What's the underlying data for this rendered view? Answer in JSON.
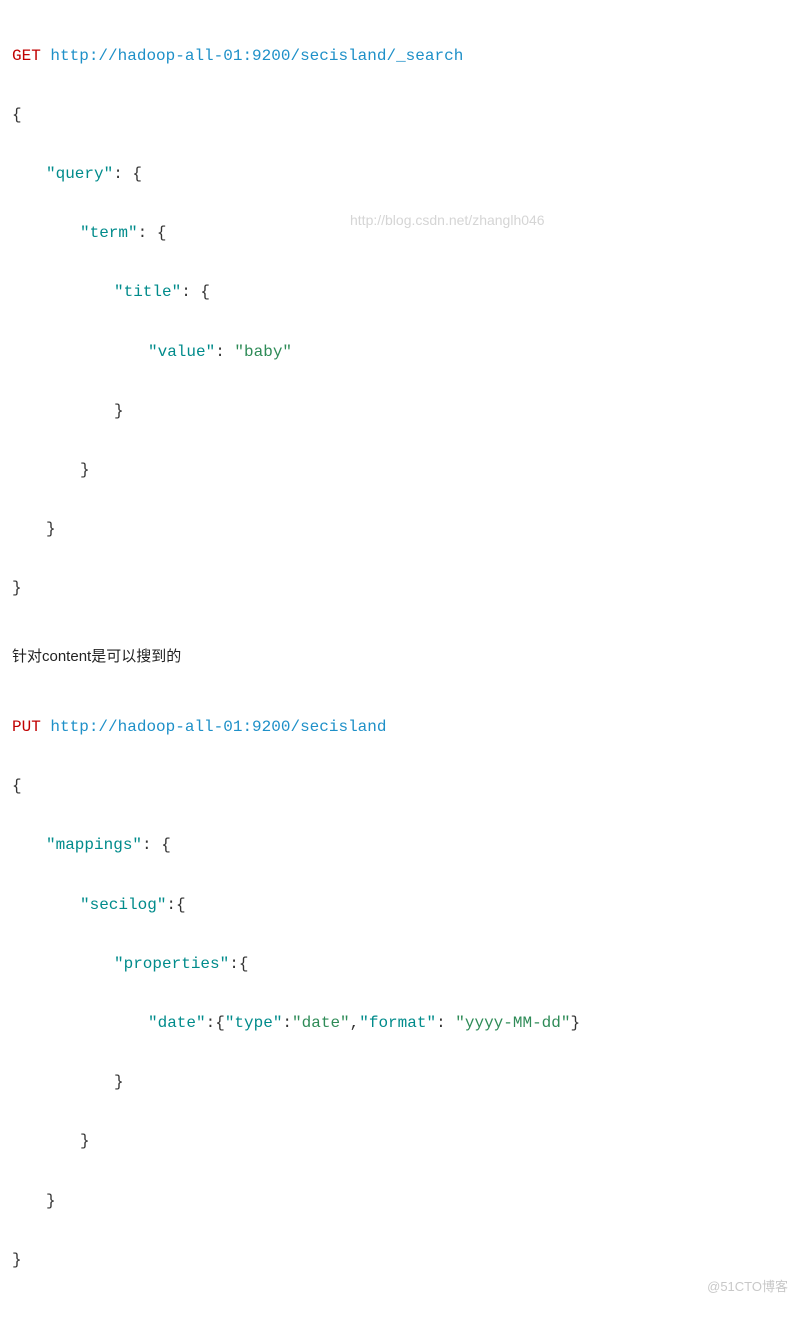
{
  "block1": {
    "method": "GET",
    "url": "http://hadoop-all-01:9200/secisland/_search",
    "b_open": "{",
    "k_query": "\"query\"",
    "k_term": "\"term\"",
    "k_title": "\"title\"",
    "k_value": "\"value\"",
    "v_baby": "\"baby\"",
    "b_close": "}"
  },
  "text_cn": "针对content是可以搜到的",
  "block2": {
    "method": "PUT",
    "url": "http://hadoop-all-01:9200/secisland",
    "b_open": "{",
    "k_mappings": "\"mappings\"",
    "k_secilog": "\"secilog\"",
    "k_properties": "\"properties\"",
    "k_date": "\"date\"",
    "k_type": "\"type\"",
    "v_date": "\"date\"",
    "k_format": "\"format\"",
    "v_format": "\"yyyy-MM-dd\"",
    "b_close": "}"
  },
  "watermark1": "http://blog.csdn.net/zhanglh046",
  "watermark_bottom": "@51CTO博客"
}
